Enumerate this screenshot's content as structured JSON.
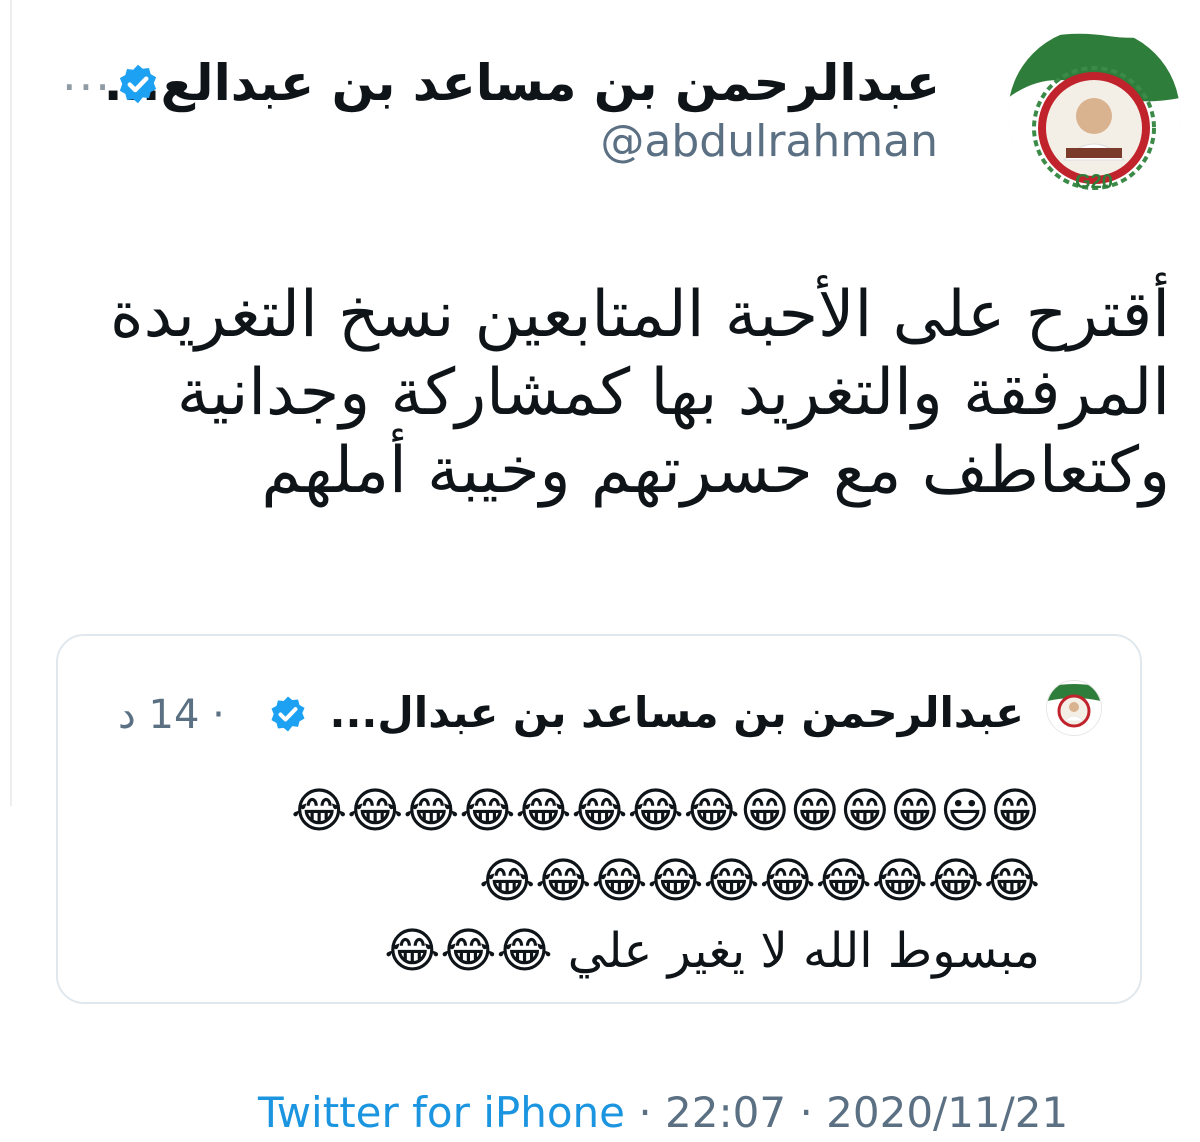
{
  "tweet": {
    "author": {
      "display_name": "عبدالرحمن بن مساعد بن عبدالع...",
      "handle": "@abdulrahman",
      "verified": true,
      "avatar_badge_text": "G20"
    },
    "text": "أقترح على الأحبة المتابعين نسخ التغريدة\nالمرفقة والتغريد بها كمشاركة وجدانية\nوكتعاطف مع حسرتهم وخيبة أملهم",
    "quoted": {
      "display_name": "عبدالرحمن بن مساعد بن عبدال...",
      "time": "· 14 د",
      "text": "😁😃😁😁😁😁😂😂😂😂😂😂😂😂\n😂😂😂😂😂😂😂😂😂😂\nمبسوط الله لا يغير علي 😂😂😂"
    },
    "footer": {
      "source": "Twitter for iPhone",
      "time": "· 22:07 ·",
      "date": "2020/11/21"
    },
    "icons": {
      "more": "more-horizontal-icon",
      "verified": "verified-badge-icon"
    },
    "colors": {
      "accent": "#1b95e0",
      "secondary_text": "#5b7083",
      "border": "#e1e8ed"
    }
  }
}
